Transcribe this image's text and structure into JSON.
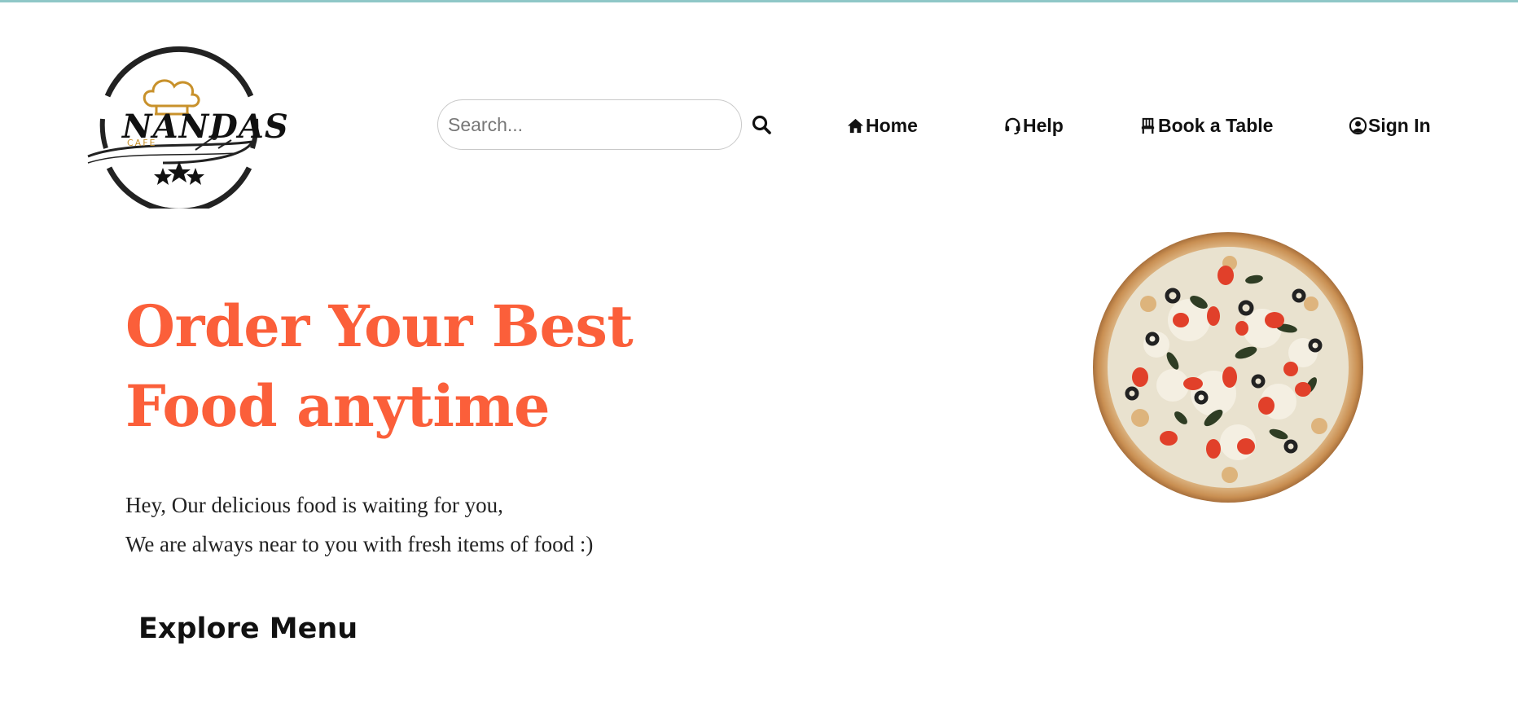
{
  "logo": {
    "name": "NANDAS",
    "tagline": "CAFE"
  },
  "search": {
    "placeholder": "Search...",
    "value": ""
  },
  "nav": {
    "home": "Home",
    "help": "Help",
    "book": "Book a Table",
    "signin": "Sign In"
  },
  "hero": {
    "title_line1": "Order Your Best",
    "title_line2": "Food anytime",
    "desc_line1": "Hey, Our delicious food is waiting for you,",
    "desc_line2": "We are always near to you with fresh items of food :)"
  },
  "explore": {
    "heading": "Explore Menu"
  },
  "colors": {
    "accent": "#fb5f3a",
    "logo_gold": "#c8912b",
    "top_strip": "#8fc7c7",
    "text_dark": "#111111"
  },
  "icons": {
    "search": "search-icon",
    "home": "home-icon",
    "help": "headset-icon",
    "book": "chair-icon",
    "signin": "user-circle-icon",
    "logo": "chef-hat-icon"
  }
}
